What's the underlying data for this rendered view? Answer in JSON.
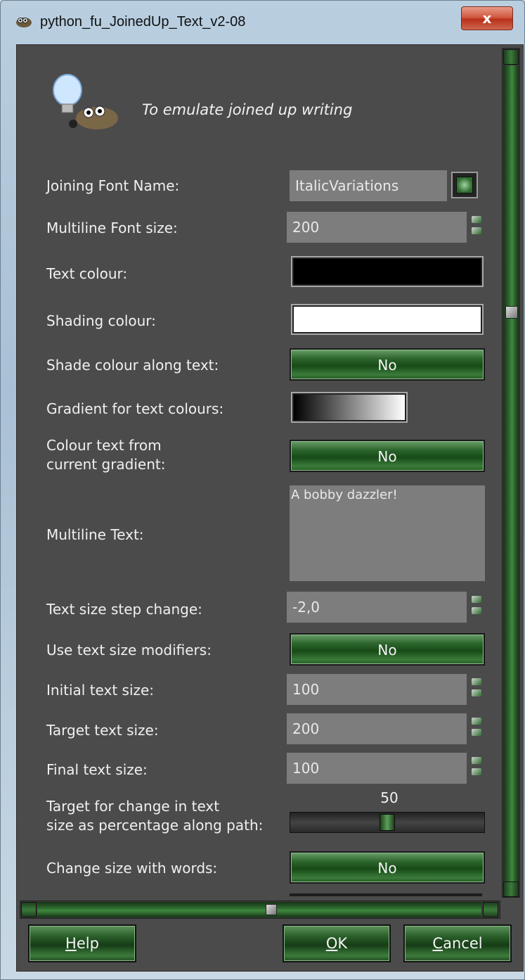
{
  "window": {
    "title": "python_fu_JoinedUp_Text_v2-08",
    "close_label": "x"
  },
  "header": {
    "description": "To emulate joined up writing"
  },
  "fields": {
    "joining_font_name": {
      "label": "Joining Font Name:",
      "value": "ItalicVariations"
    },
    "multiline_font_size": {
      "label": "Multiline Font size:",
      "value": "200"
    },
    "text_colour": {
      "label": "Text colour:",
      "color": "#000000"
    },
    "shading_colour": {
      "label": "Shading colour:",
      "color": "#ffffff"
    },
    "shade_colour_along_text": {
      "label": "Shade colour along text:",
      "value": "No"
    },
    "gradient_for_text_colours": {
      "label": "Gradient for text colours:"
    },
    "colour_text_from_gradient": {
      "label_line1": "Colour text from",
      "label_line2": "current gradient:",
      "value": "No"
    },
    "multiline_text": {
      "label": "Multiline Text:",
      "value": "A bobby dazzler!"
    },
    "text_size_step_change": {
      "label": "Text size step change:",
      "value": "-2,0"
    },
    "use_text_size_modifiers": {
      "label": "Use text size modifiers:",
      "value": "No"
    },
    "initial_text_size": {
      "label": "Initial text size:",
      "value": "100"
    },
    "target_text_size": {
      "label": "Target text size:",
      "value": "200"
    },
    "final_text_size": {
      "label": "Final text size:",
      "value": "100"
    },
    "target_change_percentage": {
      "label_line1": "Target for change in text",
      "label_line2": "size as percentage along path:",
      "value": "50",
      "fraction": 0.5
    },
    "change_size_with_words": {
      "label": "Change size with words:",
      "value": "No"
    }
  },
  "scrollbars": {
    "vertical_position_fraction": 0.3,
    "horizontal_position_fraction": 0.53
  },
  "buttons": {
    "help": {
      "underline": "H",
      "rest": "elp"
    },
    "ok": {
      "underline": "O",
      "rest": "K"
    },
    "cancel": {
      "underline": "C",
      "rest": "ancel"
    }
  },
  "colors": {
    "panel_background": "#4b4b4b",
    "button_green": "#2d662d",
    "entry_background": "#7d7d7d"
  }
}
